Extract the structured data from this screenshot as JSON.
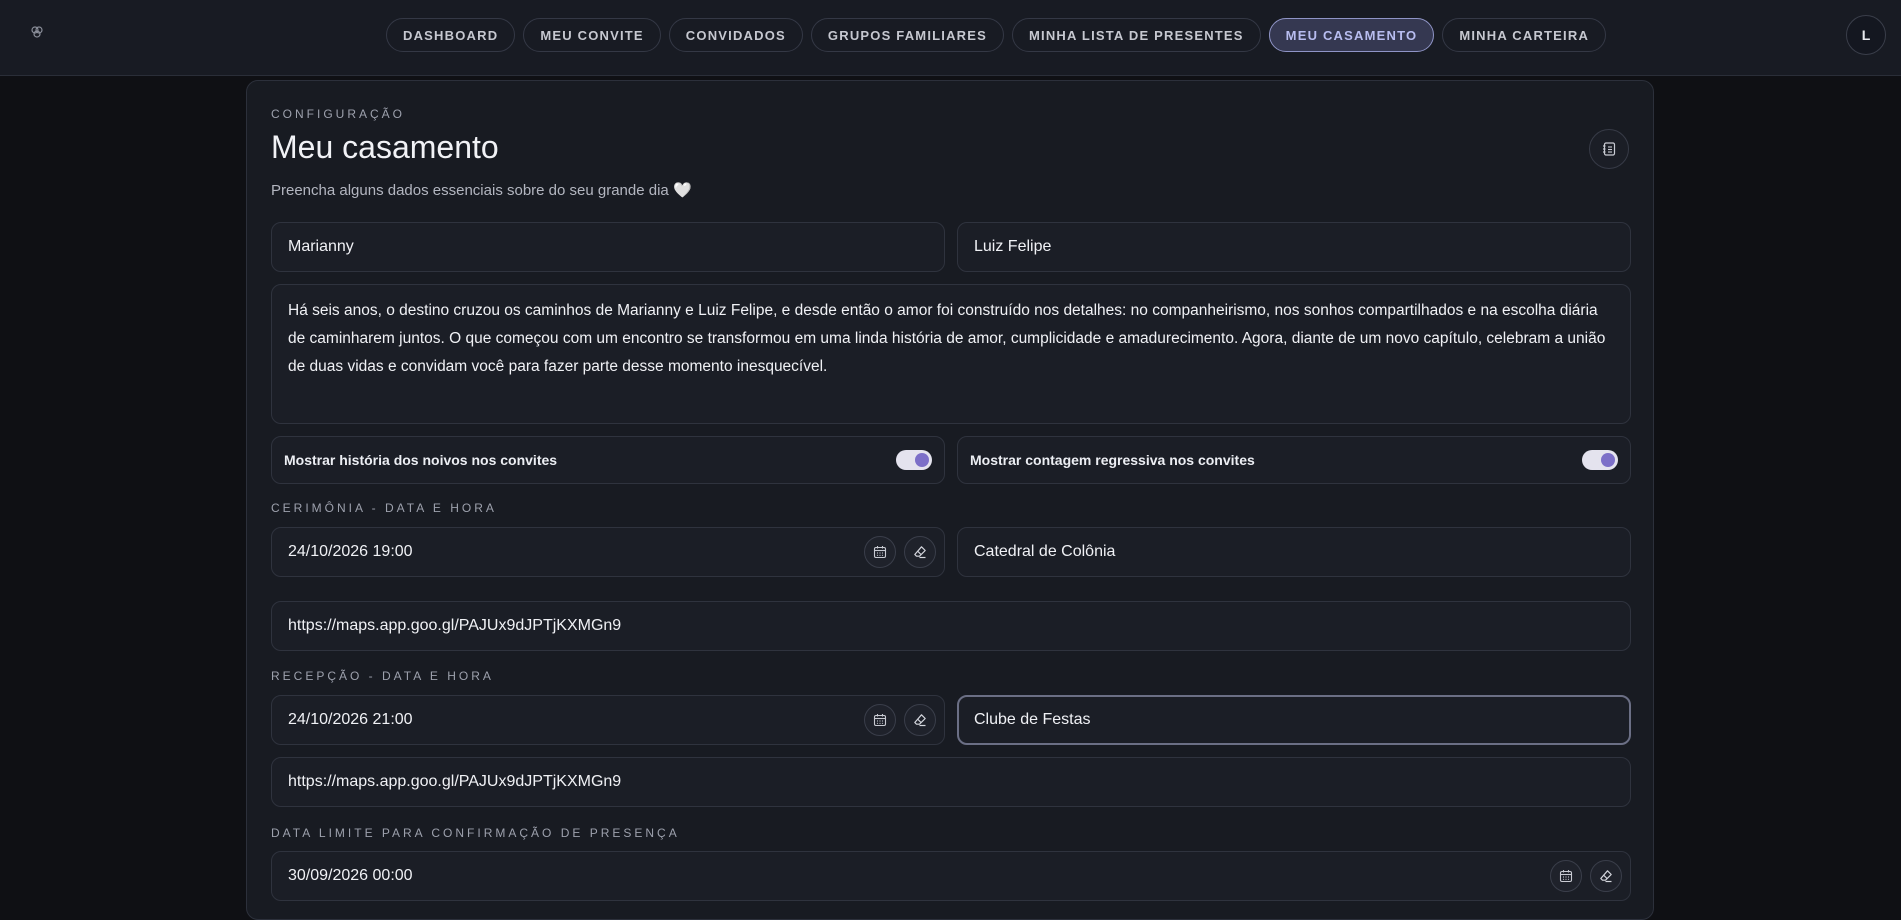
{
  "nav": {
    "items": [
      {
        "label": "DASHBOARD",
        "active": false
      },
      {
        "label": "MEU CONVITE",
        "active": false
      },
      {
        "label": "CONVIDADOS",
        "active": false
      },
      {
        "label": "GRUPOS FAMILIARES",
        "active": false
      },
      {
        "label": "MINHA LISTA DE PRESENTES",
        "active": false
      },
      {
        "label": "MEU CASAMENTO",
        "active": true
      },
      {
        "label": "MINHA CARTEIRA",
        "active": false
      }
    ],
    "avatar_initial": "L",
    "logo_icon": "flower-logo-icon"
  },
  "header": {
    "section_label": "CONFIGURAÇÃO",
    "title": "Meu casamento",
    "subtitle": "Preencha alguns dados essenciais sobre do seu grande dia",
    "heart": "🤍",
    "notes_icon": "notebook-icon"
  },
  "couple": {
    "name1": "Marianny",
    "name2": "Luiz Felipe",
    "story": "Há seis anos, o destino cruzou os caminhos de Marianny e Luiz Felipe, e desde então o amor foi construído nos detalhes: no companheirismo, nos sonhos compartilhados e na escolha diária de caminharem juntos. O que começou com um encontro se transformou em uma linda história de amor, cumplicidade e amadurecimento. Agora, diante de um novo capítulo, celebram a união de duas vidas e convidam você para fazer parte desse momento inesquecível."
  },
  "toggles": {
    "story_label": "Mostrar história dos noivos nos convites",
    "story_on": true,
    "countdown_label": "Mostrar contagem regressiva nos convites",
    "countdown_on": true
  },
  "ceremony": {
    "label": "CERIMÔNIA - DATA E HORA",
    "datetime": "24/10/2026 19:00",
    "place": "Catedral de Colônia",
    "maps_link": "https://maps.app.goo.gl/PAJUx9dJPTjKXMGn9"
  },
  "reception": {
    "label": "RECEPÇÃO - DATA E HORA",
    "datetime": "24/10/2026 21:00",
    "place": "Clube de Festas",
    "maps_link": "https://maps.app.goo.gl/PAJUx9dJPTjKXMGn9"
  },
  "rsvp": {
    "label": "DATA LIMITE PARA CONFIRMAÇÃO DE PRESENÇA",
    "datetime": "30/09/2026 00:00"
  },
  "colors": {
    "accent": "#8f94c6",
    "toggle_knob": "#7c6fc8",
    "background": "#0f1014",
    "card": "#181b22"
  }
}
